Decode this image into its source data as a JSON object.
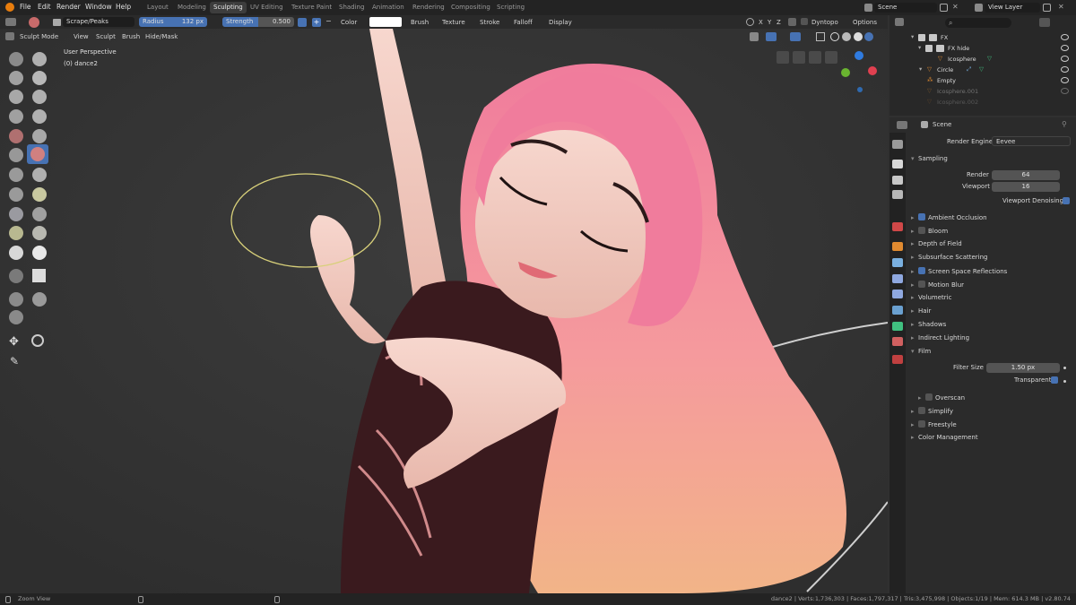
{
  "top_menu": {
    "items": [
      "File",
      "Edit",
      "Render",
      "Window",
      "Help"
    ],
    "workspaces": [
      "Layout",
      "Modeling",
      "Sculpting",
      "UV Editing",
      "Texture Paint",
      "Shading",
      "Animation",
      "Rendering",
      "Compositing",
      "Scripting"
    ],
    "active_workspace": "Sculpting",
    "scene_name": "Scene",
    "view_layer": "View Layer"
  },
  "tool_header": {
    "brush_name": "Scrape/Peaks",
    "radius_label": "Radius",
    "radius_value": "132 px",
    "strength_label": "Strength",
    "strength_value": "0.500",
    "color_label": "Color",
    "menus": [
      "Brush",
      "Texture",
      "Stroke",
      "Falloff",
      "Display"
    ],
    "axes": [
      "X",
      "Y",
      "Z"
    ],
    "dyntopo": "Dyntopo",
    "options": "Options"
  },
  "mode_header": {
    "mode": "Sculpt Mode",
    "menus": [
      "View",
      "Sculpt",
      "Brush",
      "Hide/Mask"
    ]
  },
  "viewport": {
    "perspective": "User Perspective",
    "object": "(0) dance2"
  },
  "outliner": {
    "rows": [
      {
        "name": "FX",
        "indent": 0
      },
      {
        "name": "FX hide",
        "indent": 1
      },
      {
        "name": "Icosphere",
        "indent": 2
      },
      {
        "name": "Circle",
        "indent": 1
      },
      {
        "name": "Empty",
        "indent": 1
      },
      {
        "name": "Icosphere.001",
        "indent": 1
      },
      {
        "name": "Icosphere.002",
        "indent": 1
      }
    ]
  },
  "properties": {
    "scene": "Scene",
    "render_engine_label": "Render Engine",
    "render_engine": "Eevee",
    "sampling": "Sampling",
    "render_label": "Render",
    "render_value": "64",
    "viewport_label": "Viewport",
    "viewport_value": "16",
    "viewport_denoising": "Viewport Denoising",
    "panels": [
      {
        "label": "Ambient Occlusion",
        "check": true
      },
      {
        "label": "Bloom",
        "check": false
      },
      {
        "label": "Depth of Field",
        "check": null
      },
      {
        "label": "Subsurface Scattering",
        "check": null
      },
      {
        "label": "Screen Space Reflections",
        "check": true
      },
      {
        "label": "Motion Blur",
        "check": false
      },
      {
        "label": "Volumetric",
        "check": null
      },
      {
        "label": "Hair",
        "check": null
      },
      {
        "label": "Shadows",
        "check": null
      },
      {
        "label": "Indirect Lighting",
        "check": null
      },
      {
        "label": "Film",
        "check": null
      }
    ],
    "filter_size_label": "Filter Size",
    "filter_size_value": "1.50 px",
    "transparent_label": "Transparent",
    "overscan": "Overscan",
    "more_panels": [
      {
        "label": "Simplify",
        "check": false
      },
      {
        "label": "Freestyle",
        "check": false
      },
      {
        "label": "Color Management",
        "check": null
      }
    ]
  },
  "statusbar": {
    "left": "Zoom View",
    "stats": "dance2 | Verts:1,736,303 | Faces:1,797,317 | Tris:3,475,998 | Objects:1/19 | Mem: 614.3 MB | v2.80.74"
  },
  "colors": {
    "accent": "#4772b3",
    "brush_ring": "#d8d07a",
    "hair": "#f07c9c",
    "shirt": "#3a1a1e"
  }
}
